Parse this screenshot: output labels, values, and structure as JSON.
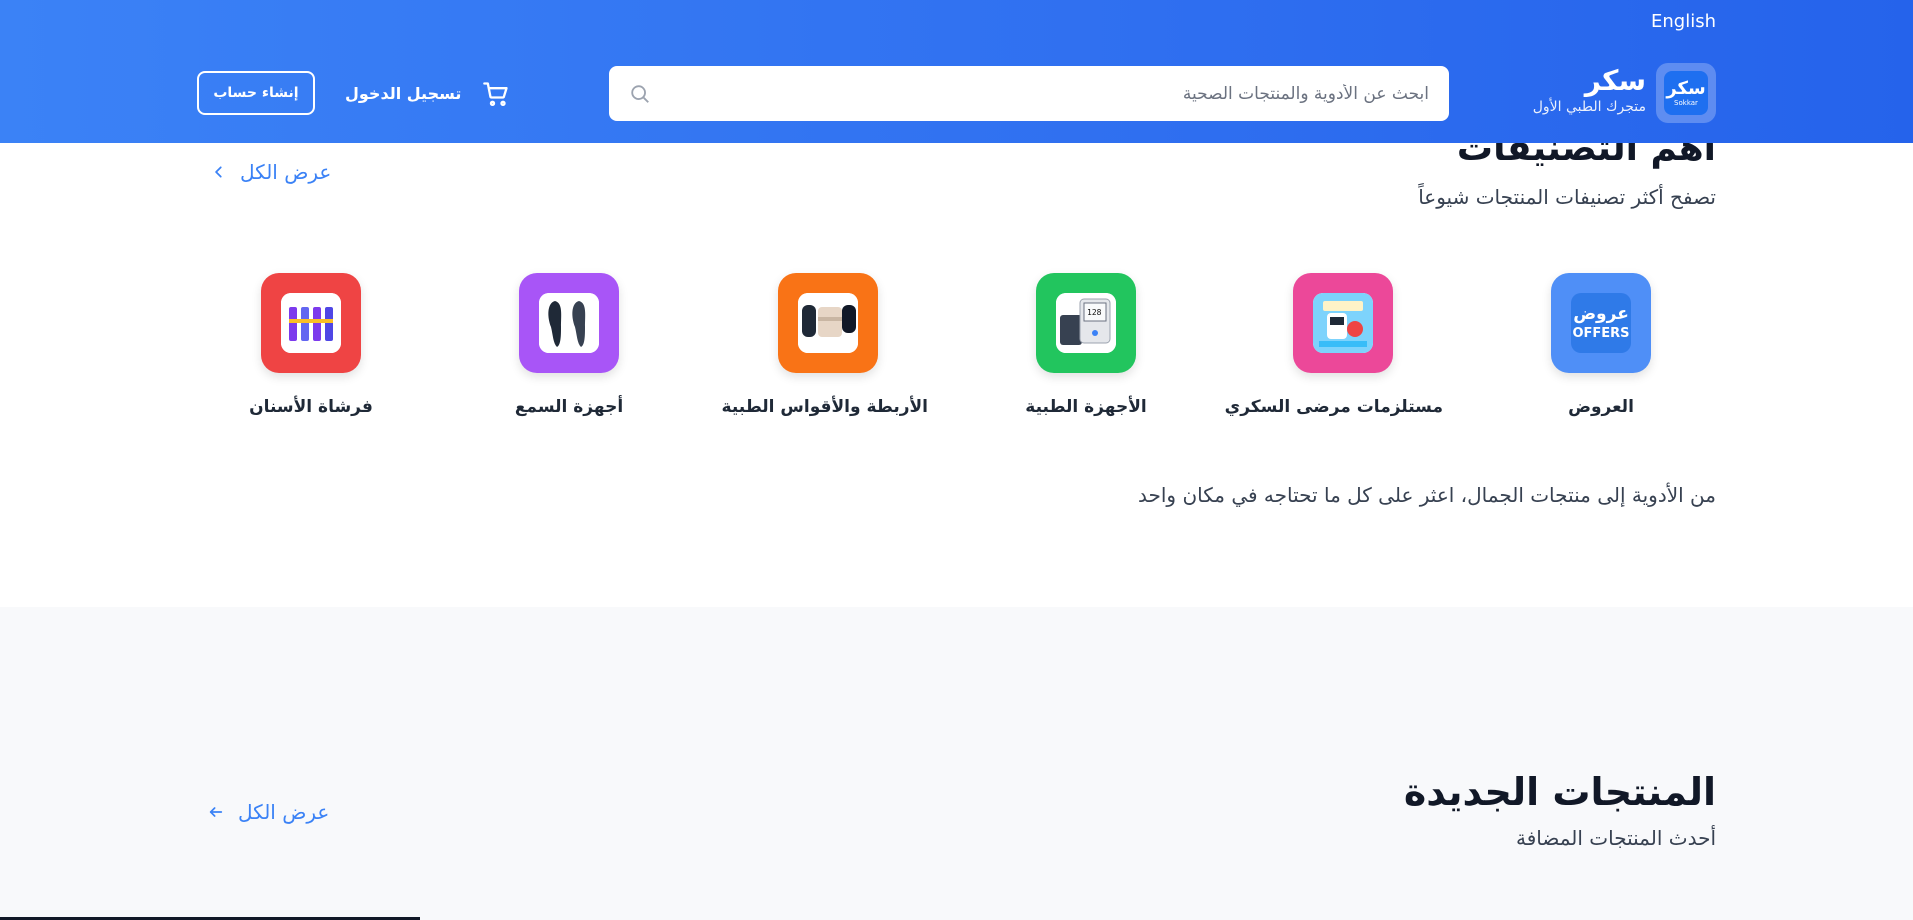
{
  "header": {
    "language_switch": "English",
    "logo_text": "سكر",
    "logo_subtext": "Sokkar",
    "brand_name": "سكر",
    "brand_tagline": "متجرك الطبي الأول",
    "search_placeholder": "ابحث عن الأدوية والمنتجات الصحية",
    "login_label": "تسجيل الدخول",
    "signup_label": "إنشاء حساب"
  },
  "categories": {
    "title": "أهم التصنيفات",
    "subtitle": "تصفح أكثر تصنيفات المنتجات شيوعاً",
    "view_all": "عرض الكل",
    "items": [
      {
        "label": "العروض",
        "tile_color": "#4f8ff7",
        "image_text_ar": "عروض",
        "image_text_en": "OFFERS"
      },
      {
        "label": "مستلزمات مرضى السكري",
        "tile_color": "#ec4899"
      },
      {
        "label": "الأجهزة الطبية",
        "tile_color": "#22c55e"
      },
      {
        "label": "الأربطة والأقواس الطبية",
        "tile_color": "#f97316"
      },
      {
        "label": "أجهزة السمع",
        "tile_color": "#a855f7"
      },
      {
        "label": "فرشاة الأسنان",
        "tile_color": "#ef4444"
      }
    ],
    "tagline": "من الأدوية إلى منتجات الجمال، اعثر على كل ما تحتاجه في مكان واحد"
  },
  "new_products": {
    "title": "المنتجات الجديدة",
    "subtitle": "أحدث المنتجات المضافة",
    "view_all": "عرض الكل"
  },
  "colors": {
    "header_gradient_start": "#3b82f6",
    "header_gradient_end": "#2563eb",
    "accent": "#3b82f6"
  }
}
